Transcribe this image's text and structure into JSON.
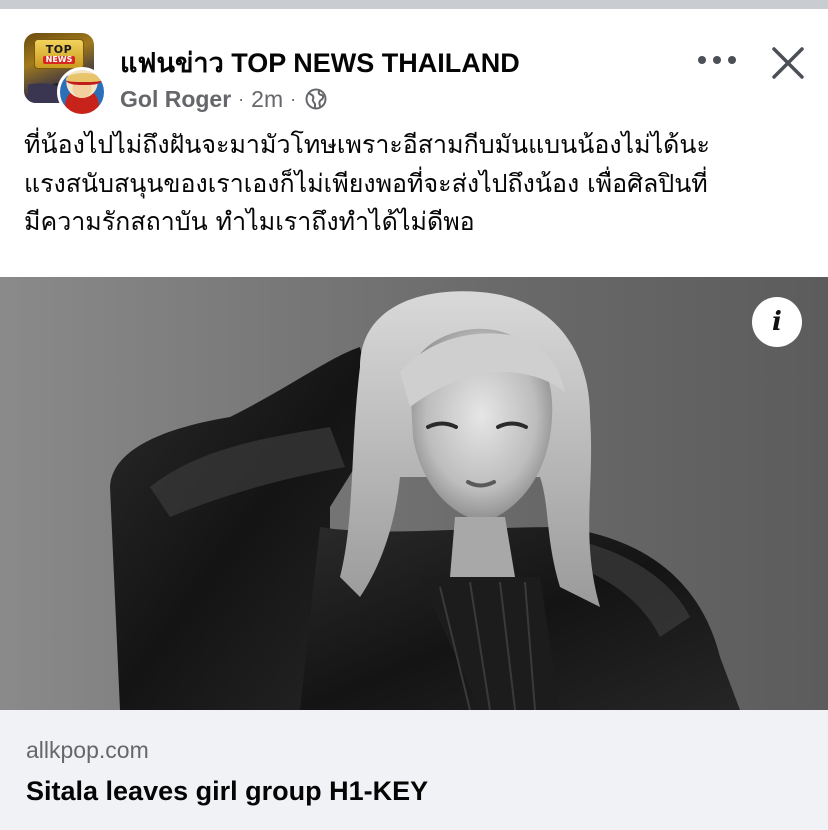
{
  "post": {
    "page_name": "แฟนข่าว TOP NEWS THAILAND",
    "author": "Gol Roger",
    "time": "2m",
    "separator": "·",
    "page_logo": {
      "line1": "TOP",
      "line2": "NEWS"
    },
    "icons": {
      "audience": "globe-icon",
      "more": "more-options-icon",
      "close": "close-icon",
      "info": "info-icon"
    },
    "text_lines": [
      "ที่น้องไปไม่ถึงฝันจะมามัวโทษเพราะอีสามกีบมันแบนน้องไม่ได้นะ",
      "แรงสนับสนุนของเราเองก็ไม่เพียงพอที่จะส่งไปถึงน้อง เพื่อศิลปินที่",
      "มีความรักสถาบัน ทำไมเราถึงทำได้ไม่ดีพอ"
    ]
  },
  "image": {
    "info_label": "i"
  },
  "link_preview": {
    "domain": "allkpop.com",
    "title": "Sitala leaves girl group H1-KEY"
  },
  "colors": {
    "secondary_text": "#65676b",
    "link_preview_bg": "#f0f2f5",
    "divider": "#c9ccd1"
  }
}
